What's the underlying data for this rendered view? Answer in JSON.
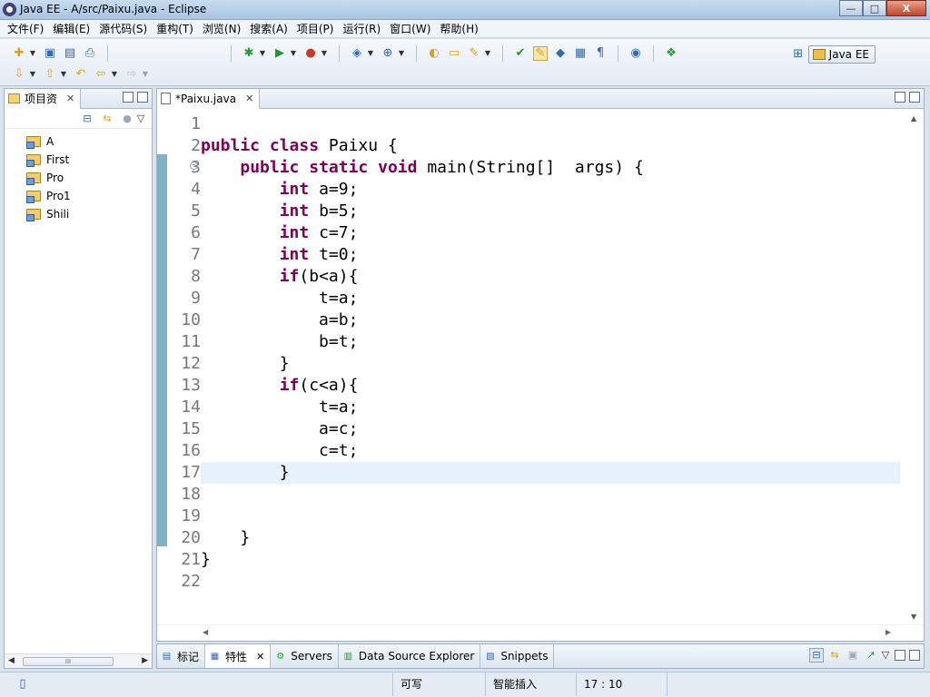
{
  "window": {
    "title": "Java EE  - A/src/Paixu.java  - Eclipse",
    "controls": {
      "minimize": "—",
      "maximize": "□",
      "close": "X"
    }
  },
  "menu": [
    "文件(F)",
    "编辑(E)",
    "源代码(S)",
    "重构(T)",
    "浏览(N)",
    "搜索(A)",
    "项目(P)",
    "运行(R)",
    "窗口(W)",
    "帮助(H)"
  ],
  "perspective": {
    "label": "Java EE"
  },
  "left_view": {
    "tab_label": "项目资",
    "projects": [
      "A",
      "First",
      "Pro",
      "Pro1",
      "Shili"
    ],
    "scroll_thumb": "III"
  },
  "editor": {
    "tab_label": "*Paixu.java",
    "line_numbers": [
      "1",
      "2",
      "3",
      "4",
      "5",
      "6",
      "7",
      "8",
      "9",
      "10",
      "11",
      "12",
      "13",
      "14",
      "15",
      "16",
      "17",
      "18",
      "19",
      "20",
      "21",
      "22"
    ],
    "current_line": 17,
    "lines": [
      "",
      "public class Paixu {",
      "    public static void main(String[]  args) {",
      "        int a=9;",
      "        int b=5;",
      "        int c=7;",
      "        int t=0;",
      "        if(b<a){",
      "            t=a;",
      "            a=b;",
      "            b=t;",
      "        }",
      "        if(c<a){",
      "            t=a;",
      "            a=c;",
      "            c=t;",
      "        }",
      "",
      "",
      "    }",
      "}",
      ""
    ],
    "keywords": [
      "public",
      "class",
      "static",
      "void",
      "int",
      "if"
    ]
  },
  "bottom_panel": {
    "tabs": [
      {
        "label": "标记",
        "active": false
      },
      {
        "label": "特性",
        "active": true
      },
      {
        "label": "Servers",
        "active": false
      },
      {
        "label": "Data Source Explorer",
        "active": false
      },
      {
        "label": "Snippets",
        "active": false
      }
    ]
  },
  "status": {
    "writable": "可写",
    "insert_mode": "智能插入",
    "position": "17 : 10"
  }
}
